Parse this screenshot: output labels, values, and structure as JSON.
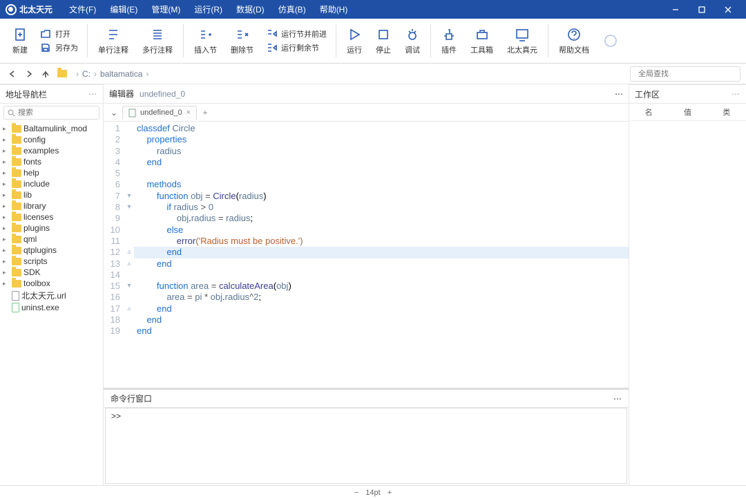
{
  "app": {
    "name": "北太天元"
  },
  "menu": {
    "file": "文件(F)",
    "edit": "编辑(E)",
    "manage": "管理(M)",
    "run": "运行(R)",
    "data": "数据(D)",
    "sim": "仿真(B)",
    "help": "帮助(H)"
  },
  "toolbar": {
    "new": "新建",
    "open": "打开",
    "saveas": "另存为",
    "single_comment": "单行注释",
    "multi_comment": "多行注释",
    "insert_section": "插入节",
    "delete_section": "删除节",
    "run_section_forward": "运行节并前进",
    "run_remaining_sections": "运行剩余节",
    "run": "运行",
    "stop": "停止",
    "debug": "调试",
    "plugins": "插件",
    "toolbox": "工具箱",
    "btzy": "北太真元",
    "help_docs": "帮助文档"
  },
  "location": {
    "back": "back",
    "fwd": "fwd",
    "up": "up",
    "drive": "C:",
    "folder": "baltamatica"
  },
  "search": {
    "global_placeholder": "全局查找",
    "fs_placeholder": "搜索"
  },
  "sidebar": {
    "title": "地址导航栏",
    "items": [
      {
        "label": "Baltamulink_mod",
        "type": "folder"
      },
      {
        "label": "config",
        "type": "folder"
      },
      {
        "label": "examples",
        "type": "folder"
      },
      {
        "label": "fonts",
        "type": "folder"
      },
      {
        "label": "help",
        "type": "folder"
      },
      {
        "label": "include",
        "type": "folder"
      },
      {
        "label": "lib",
        "type": "folder"
      },
      {
        "label": "library",
        "type": "folder"
      },
      {
        "label": "licenses",
        "type": "folder"
      },
      {
        "label": "plugins",
        "type": "folder"
      },
      {
        "label": "qml",
        "type": "folder"
      },
      {
        "label": "qtplugins",
        "type": "folder"
      },
      {
        "label": "scripts",
        "type": "folder"
      },
      {
        "label": "SDK",
        "type": "folder"
      },
      {
        "label": "toolbox",
        "type": "folder"
      },
      {
        "label": "北太天元.url",
        "type": "url"
      },
      {
        "label": "uninst.exe",
        "type": "exe"
      }
    ]
  },
  "editor": {
    "title": "编辑器",
    "doc": "undefined_0",
    "tab": "undefined_0"
  },
  "code": {
    "lines": [
      {
        "n": 1,
        "fold": "",
        "hl": false,
        "html": "<span class='kw'>classdef</span> <span class='id'>Circle</span>"
      },
      {
        "n": 2,
        "fold": "",
        "hl": false,
        "html": "    <span class='kw'>properties</span>"
      },
      {
        "n": 3,
        "fold": "",
        "hl": false,
        "html": "        <span class='id'>radius</span>"
      },
      {
        "n": 4,
        "fold": "",
        "hl": false,
        "html": "    <span class='kw'>end</span>"
      },
      {
        "n": 5,
        "fold": "",
        "hl": false,
        "html": ""
      },
      {
        "n": 6,
        "fold": "",
        "hl": false,
        "html": "    <span class='kw'>methods</span>"
      },
      {
        "n": 7,
        "fold": "▾",
        "hl": false,
        "html": "        <span class='kw'>function</span> <span class='id'>obj</span> <span class='op'>=</span> <span class='fn'>Circle</span>(<span class='id'>radius</span>)"
      },
      {
        "n": 8,
        "fold": "▾",
        "hl": false,
        "html": "            <span class='kw'>if</span> <span class='id'>radius</span> <span class='op'>&gt;</span> <span class='id'>0</span>"
      },
      {
        "n": 9,
        "fold": "",
        "hl": false,
        "html": "                <span class='id'>obj</span>.<span class='id'>radius</span> <span class='op'>=</span> <span class='id'>radius</span>;"
      },
      {
        "n": 10,
        "fold": "",
        "hl": false,
        "html": "            <span class='kw'>else</span>"
      },
      {
        "n": 11,
        "fold": "",
        "hl": false,
        "html": "                <span class='fn'>error</span><span class='punct'>(</span><span class='str'>'Radius must be positive.'</span><span class='punct'>)</span>"
      },
      {
        "n": 12,
        "fold": "▵",
        "hl": true,
        "html": "            <span class='kw'>end</span>"
      },
      {
        "n": 13,
        "fold": "▵",
        "hl": false,
        "html": "        <span class='kw'>end</span>"
      },
      {
        "n": 14,
        "fold": "",
        "hl": false,
        "html": ""
      },
      {
        "n": 15,
        "fold": "▾",
        "hl": false,
        "html": "        <span class='kw'>function</span> <span class='id'>area</span> <span class='op'>=</span> <span class='fn'>calculateArea</span>(<span class='id'>obj</span>)"
      },
      {
        "n": 16,
        "fold": "",
        "hl": false,
        "html": "            <span class='id'>area</span> <span class='op'>=</span> <span class='id'>pi</span> <span class='op'>*</span> <span class='id'>obj</span>.<span class='id'>radius</span><span class='op'>^</span><span class='id'>2</span>;"
      },
      {
        "n": 17,
        "fold": "▵",
        "hl": false,
        "html": "        <span class='kw'>end</span>"
      },
      {
        "n": 18,
        "fold": "",
        "hl": false,
        "html": "    <span class='kw'>end</span>"
      },
      {
        "n": 19,
        "fold": "",
        "hl": false,
        "html": "<span class='kw'>end</span>"
      }
    ]
  },
  "console": {
    "title": "命令行窗口",
    "prompt": ">>"
  },
  "workspace": {
    "title": "工作区",
    "cols": {
      "name": "名",
      "value": "值",
      "type": "类"
    }
  },
  "status": {
    "fontsize": "14pt",
    "minus": "−",
    "plus": "+"
  }
}
